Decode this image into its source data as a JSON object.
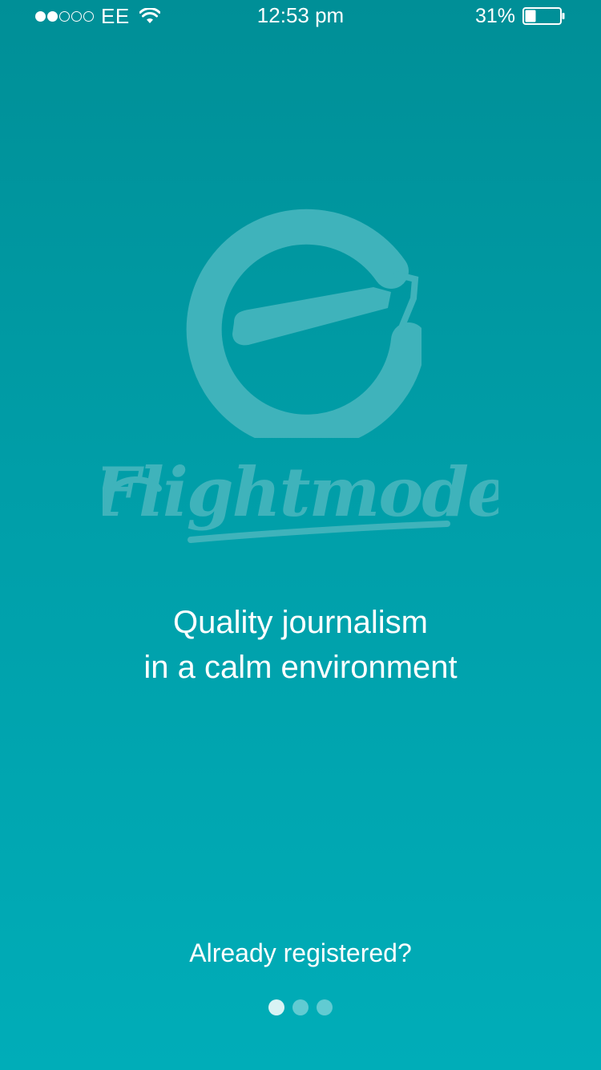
{
  "status_bar": {
    "signal_bars_filled": 2,
    "signal_bars_total": 5,
    "carrier": "EE",
    "network_icon": "wifi-icon",
    "time": "12:53 pm",
    "battery_percent": "31%",
    "battery_level": 0.31
  },
  "onboarding": {
    "logo_icon": "flightmode-logo-icon",
    "brand_wordmark": "Flightmode",
    "tagline_line1": "Quality journalism",
    "tagline_line2": "in a calm environment",
    "login_link": "Already registered?",
    "pager": {
      "total": 3,
      "active_index": 0
    }
  },
  "colors": {
    "background_top": "#008f97",
    "background_bottom": "#00adb8",
    "logo": "#3fb3bb",
    "text": "#ffffff"
  }
}
